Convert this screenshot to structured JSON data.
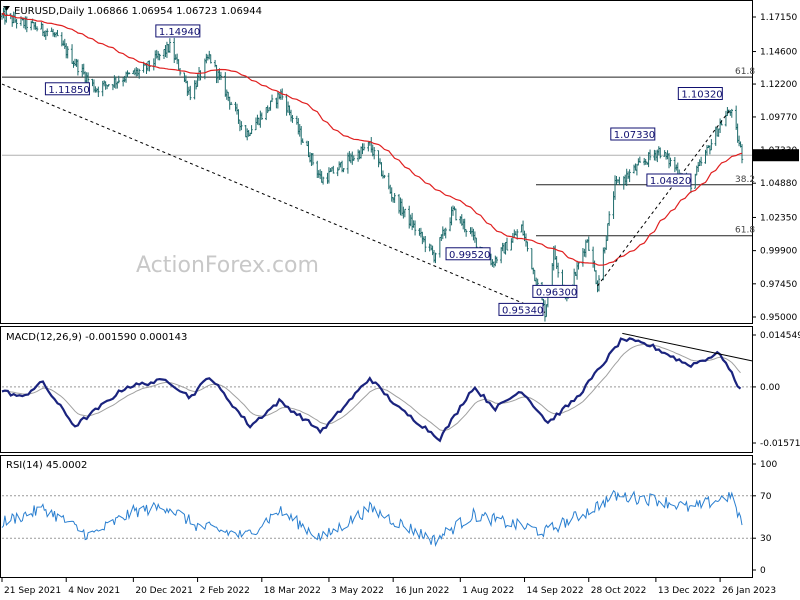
{
  "chart_data": {
    "type": "candlestick",
    "symbol": "EURUSD,Daily",
    "ohlc_header": "1.06866 1.06954 1.06723 1.06944",
    "watermark": "ActionForex.com",
    "last_price_label": "1.06944",
    "price_axis_ticks": [
      "1.17150",
      "1.14600",
      "1.12200",
      "1.09770",
      "1.07330",
      "1.04880",
      "1.02350",
      "0.99900",
      "0.97450",
      "0.95000"
    ],
    "date_axis_ticks": [
      "21 Sep 2021",
      "4 Nov 2021",
      "20 Dec 2021",
      "2 Feb 2022",
      "18 Mar 2022",
      "3 May 2022",
      "16 Jun 2022",
      "1 Aug 2022",
      "14 Sep 2022",
      "28 Oct 2022",
      "13 Dec 2022",
      "26 Jan 2023"
    ],
    "price_range": [
      0.95,
      1.1715
    ],
    "price_waypoints": [
      {
        "date": "2021-09-21",
        "price": 1.172
      },
      {
        "date": "2021-10-25",
        "price": 1.16
      },
      {
        "date": "2021-11-24",
        "price": 1.1185
      },
      {
        "date": "2021-12-28",
        "price": 1.133
      },
      {
        "date": "2022-01-14",
        "price": 1.1494
      },
      {
        "date": "2022-01-28",
        "price": 1.115
      },
      {
        "date": "2022-02-10",
        "price": 1.142
      },
      {
        "date": "2022-03-07",
        "price": 1.085
      },
      {
        "date": "2022-03-31",
        "price": 1.115
      },
      {
        "date": "2022-04-28",
        "price": 1.051
      },
      {
        "date": "2022-05-31",
        "price": 1.077
      },
      {
        "date": "2022-06-15",
        "price": 1.04
      },
      {
        "date": "2022-07-14",
        "price": 0.9952
      },
      {
        "date": "2022-07-27",
        "price": 1.028
      },
      {
        "date": "2022-08-23",
        "price": 0.99
      },
      {
        "date": "2022-09-12",
        "price": 1.016
      },
      {
        "date": "2022-09-28",
        "price": 0.9534
      },
      {
        "date": "2022-10-04",
        "price": 0.998
      },
      {
        "date": "2022-10-13",
        "price": 0.963
      },
      {
        "date": "2022-10-27",
        "price": 1.008
      },
      {
        "date": "2022-11-03",
        "price": 0.973
      },
      {
        "date": "2022-11-15",
        "price": 1.047
      },
      {
        "date": "2022-12-15",
        "price": 1.0733
      },
      {
        "date": "2023-01-06",
        "price": 1.0482
      },
      {
        "date": "2023-01-26",
        "price": 1.092
      },
      {
        "date": "2023-02-02",
        "price": 1.1032
      },
      {
        "date": "2023-02-10",
        "price": 1.0694
      }
    ],
    "moving_average_color": "#e02020",
    "candle_color": "#1e6b6b",
    "annotations": [
      {
        "label": "1.14940",
        "price": 1.1494
      },
      {
        "label": "1.11850",
        "price": 1.1185
      },
      {
        "label": "1.10320",
        "price": 1.1032
      },
      {
        "label": "1.07330",
        "price": 1.0733
      },
      {
        "label": "1.04820",
        "price": 1.0482
      },
      {
        "label": "0.99520",
        "price": 0.9952
      },
      {
        "label": "0.96300",
        "price": 0.963
      },
      {
        "label": "0.95340",
        "price": 0.9534
      }
    ],
    "fib_levels": [
      {
        "label": "61.8",
        "price": 1.1271
      },
      {
        "label": "38.2",
        "price": 1.0476
      },
      {
        "label": "61.8",
        "price": 1.01
      }
    ],
    "macd": {
      "label": "MACD(12,26,9) -0.001590 0.000143",
      "ticks": [
        "0.014549",
        "0.00",
        "-0.015712"
      ],
      "range": [
        -0.015712,
        0.014549
      ],
      "waypoints": [
        {
          "date": "2021-09-21",
          "value": -0.001
        },
        {
          "date": "2021-10-05",
          "value": -0.003
        },
        {
          "date": "2021-10-18",
          "value": 0.0015
        },
        {
          "date": "2021-11-10",
          "value": -0.011
        },
        {
          "date": "2021-12-15",
          "value": 0.0
        },
        {
          "date": "2022-01-12",
          "value": 0.002
        },
        {
          "date": "2022-01-28",
          "value": -0.003
        },
        {
          "date": "2022-02-10",
          "value": 0.003
        },
        {
          "date": "2022-03-10",
          "value": -0.011
        },
        {
          "date": "2022-03-30",
          "value": -0.004
        },
        {
          "date": "2022-04-28",
          "value": -0.0125
        },
        {
          "date": "2022-05-31",
          "value": 0.0025
        },
        {
          "date": "2022-06-20",
          "value": -0.006
        },
        {
          "date": "2022-07-18",
          "value": -0.0145
        },
        {
          "date": "2022-08-10",
          "value": 0.0
        },
        {
          "date": "2022-08-25",
          "value": -0.006
        },
        {
          "date": "2022-09-12",
          "value": -0.001
        },
        {
          "date": "2022-09-30",
          "value": -0.01
        },
        {
          "date": "2022-10-20",
          "value": -0.003
        },
        {
          "date": "2022-11-20",
          "value": 0.0135
        },
        {
          "date": "2022-12-10",
          "value": 0.0115
        },
        {
          "date": "2023-01-05",
          "value": 0.006
        },
        {
          "date": "2023-01-26",
          "value": 0.0095
        },
        {
          "date": "2023-02-10",
          "value": -0.0016
        }
      ],
      "divergence_line_color": "#000000",
      "line_color": "#1a237e",
      "signal_color": "#a0a0a0"
    },
    "rsi": {
      "label": "RSI(14) 45.0002",
      "ticks": [
        "100",
        "70",
        "30",
        "0"
      ],
      "range": [
        0,
        100
      ],
      "levels": [
        70,
        30
      ],
      "waypoints": [
        {
          "date": "2021-09-21",
          "value": 45
        },
        {
          "date": "2021-10-20",
          "value": 58
        },
        {
          "date": "2021-11-20",
          "value": 32
        },
        {
          "date": "2021-12-20",
          "value": 55
        },
        {
          "date": "2022-01-12",
          "value": 60
        },
        {
          "date": "2022-02-01",
          "value": 42
        },
        {
          "date": "2022-03-07",
          "value": 32
        },
        {
          "date": "2022-03-30",
          "value": 56
        },
        {
          "date": "2022-04-28",
          "value": 30
        },
        {
          "date": "2022-05-31",
          "value": 58
        },
        {
          "date": "2022-07-14",
          "value": 28
        },
        {
          "date": "2022-08-10",
          "value": 52
        },
        {
          "date": "2022-09-28",
          "value": 36
        },
        {
          "date": "2022-10-27",
          "value": 55
        },
        {
          "date": "2022-11-15",
          "value": 70
        },
        {
          "date": "2022-12-15",
          "value": 66
        },
        {
          "date": "2023-01-06",
          "value": 58
        },
        {
          "date": "2023-02-02",
          "value": 70
        },
        {
          "date": "2023-02-10",
          "value": 45
        }
      ],
      "line_color": "#2a7fd0"
    }
  }
}
